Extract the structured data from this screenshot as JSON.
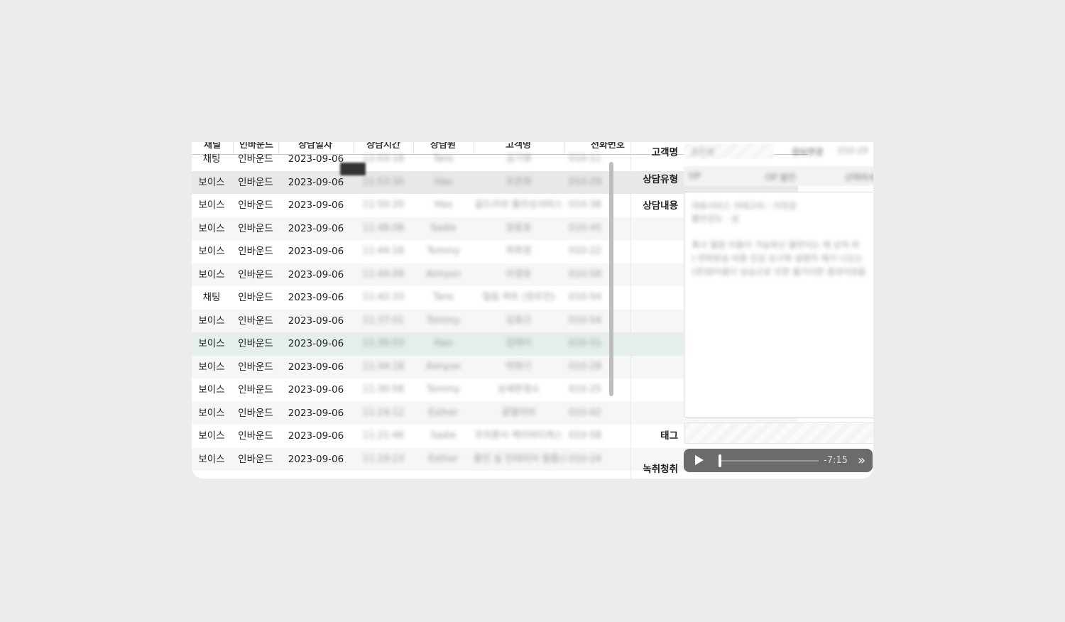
{
  "table": {
    "headers": [
      "채널",
      "인바운드",
      "상담일자",
      "상담시간",
      "상담원",
      "고객명",
      "전화번호"
    ],
    "rows": [
      {
        "channel": "채팅",
        "direction": "인바운드",
        "date": "2023-09-06",
        "time": "12:03:18",
        "agent": "Tans",
        "customer": "김기영",
        "phone": "010-11"
      },
      {
        "channel": "보이스",
        "direction": "인바운드",
        "date": "2023-09-06",
        "time": "11:53:30",
        "agent": "Hao",
        "customer": "조은희",
        "phone": "010-29"
      },
      {
        "channel": "보이스",
        "direction": "인바운드",
        "date": "2023-09-06",
        "time": "11:50:20",
        "agent": "Hao",
        "customer": "골드러쉬 플러싱서비스",
        "phone": "010-38"
      },
      {
        "channel": "보이스",
        "direction": "인바운드",
        "date": "2023-09-06",
        "time": "11:48:08",
        "agent": "Sadie",
        "customer": "정동호",
        "phone": "010-45"
      },
      {
        "channel": "보이스",
        "direction": "인바운드",
        "date": "2023-09-06",
        "time": "11:44:18",
        "agent": "Tommy",
        "customer": "최희정",
        "phone": "010-22"
      },
      {
        "channel": "보이스",
        "direction": "인바운드",
        "date": "2023-09-06",
        "time": "11:44:09",
        "agent": "Aimyon",
        "customer": "이경호",
        "phone": "010-58"
      },
      {
        "channel": "채팅",
        "direction": "인바운드",
        "date": "2023-09-06",
        "time": "11:42:33",
        "agent": "Tans",
        "customer": "얼음 하트 (장르친)",
        "phone": "010-54"
      },
      {
        "channel": "보이스",
        "direction": "인바운드",
        "date": "2023-09-06",
        "time": "11:37:01",
        "agent": "Tommy",
        "customer": "김효근",
        "phone": "010-54"
      },
      {
        "channel": "보이스",
        "direction": "인바운드",
        "date": "2023-09-06",
        "time": "11:36:03",
        "agent": "Hao",
        "customer": "김태이",
        "phone": "010-51"
      },
      {
        "channel": "보이스",
        "direction": "인바운드",
        "date": "2023-09-06",
        "time": "11:34:18",
        "agent": "Aimyon",
        "customer": "박현기",
        "phone": "010-28"
      },
      {
        "channel": "보이스",
        "direction": "인바운드",
        "date": "2023-09-06",
        "time": "11:30:58",
        "agent": "Tommy",
        "customer": "상세한정소",
        "phone": "010-25"
      },
      {
        "channel": "보이스",
        "direction": "인바운드",
        "date": "2023-09-06",
        "time": "11:24:12",
        "agent": "Esther",
        "customer": "광열이비",
        "phone": "010-42"
      },
      {
        "channel": "보이스",
        "direction": "인바운드",
        "date": "2023-09-06",
        "time": "11:21:46",
        "agent": "Sadie",
        "customer": "우리환서 케이비티케스",
        "phone": "010-58"
      },
      {
        "channel": "보이스",
        "direction": "인바운드",
        "date": "2023-09-06",
        "time": "11:19:23",
        "agent": "Esther",
        "customer": "활진 실 인테리어 철릅스",
        "phone": "010-24"
      }
    ]
  },
  "detail": {
    "customer_label": "고객명",
    "type_label": "상담유형",
    "content_label": "상담내용",
    "tag_label": "태그",
    "recording_label": "녹취청취",
    "customer_value": "조은희",
    "customer_btn": "정보변경",
    "customer_phone": "010-29",
    "type_1": "OP",
    "type_2": "OP 불만",
    "type_3": "선택하세요",
    "content_lines": [
      "대표서비스 카테고리 : 이전감",
      "불만강도 : 상",
      "",
      "혹시 혈점 이용이 가능하신 불만이는 제 상처 피",
      ") 연락받숨 비용 인상 요구와 설명의 제기 나오는",
      "(관)방어용이 상승으로 인한 불가이한 결과이었음"
    ],
    "player": {
      "remaining": "-7:15",
      "progress": 0.02
    }
  }
}
